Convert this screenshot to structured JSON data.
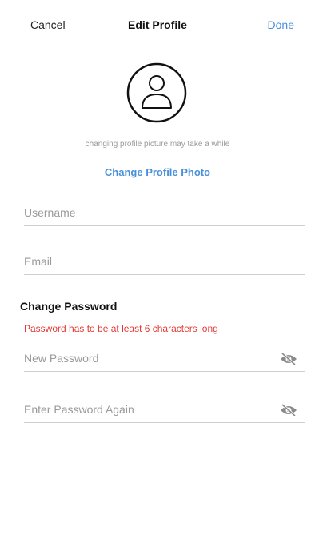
{
  "nav": {
    "cancel_label": "Cancel",
    "title": "Edit Profile",
    "done_label": "Done"
  },
  "profile": {
    "avatar_icon": "user-icon",
    "hint": "changing profile picture may take a while",
    "change_photo_label": "Change Profile Photo"
  },
  "form": {
    "username_placeholder": "Username",
    "email_placeholder": "Email"
  },
  "password": {
    "section_title": "Change Password",
    "error": "Password has to be at least 6 characters long",
    "new_placeholder": "New Password",
    "confirm_placeholder": "Enter Password Again",
    "visibility_icon": "eye-off-icon"
  },
  "colors": {
    "accent": "#4a90d9",
    "error": "#e53935"
  }
}
